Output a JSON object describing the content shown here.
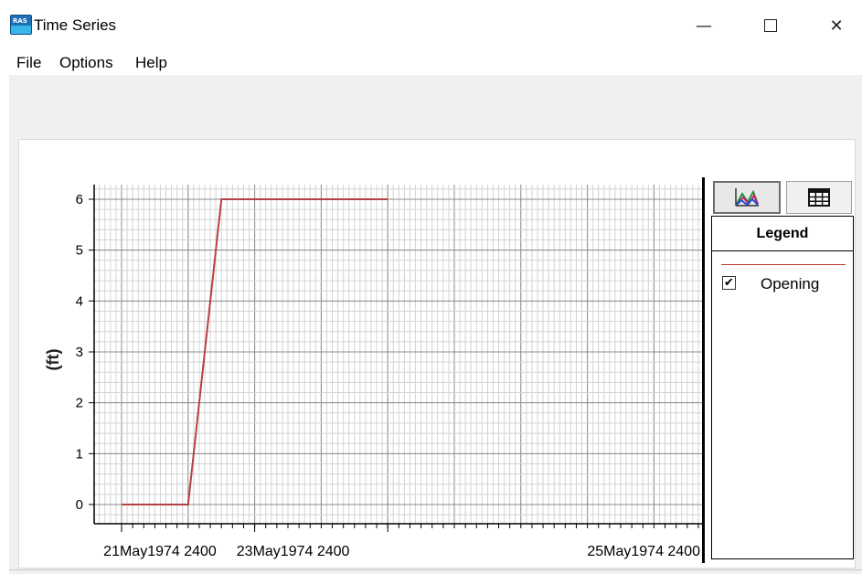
{
  "window": {
    "title": "Time Series",
    "minimize_glyph": "—",
    "close_glyph": "✕",
    "app_icon_text": "RAS"
  },
  "menu": {
    "items": [
      {
        "label": "File"
      },
      {
        "label": "Options"
      },
      {
        "label": "Help"
      }
    ]
  },
  "sidebar": {
    "plot_view_icon": "line-chart-icon",
    "table_view_icon": "table-grid-icon",
    "legend_title": "Legend",
    "legend_items": [
      {
        "label": "Opening",
        "checked": true,
        "check_glyph": "✔",
        "color": "#c0392b"
      }
    ]
  },
  "chart_data": {
    "type": "line",
    "title": "",
    "xlabel": "",
    "ylabel": "(ft)",
    "ylim": [
      0,
      6
    ],
    "yticks": [
      "0",
      "1",
      "2",
      "3",
      "4",
      "5",
      "6"
    ],
    "xticks": [
      "21May1974 2400",
      "23May1974 2400",
      "25May1974 2400"
    ],
    "grid": true,
    "series": [
      {
        "name": "Opening",
        "color": "#b84040",
        "x": [
          "21May1974 2400",
          "23May1974 0000",
          "23May1974 1200",
          "26May1974 0000"
        ],
        "y": [
          0,
          0,
          6,
          6
        ]
      }
    ]
  }
}
